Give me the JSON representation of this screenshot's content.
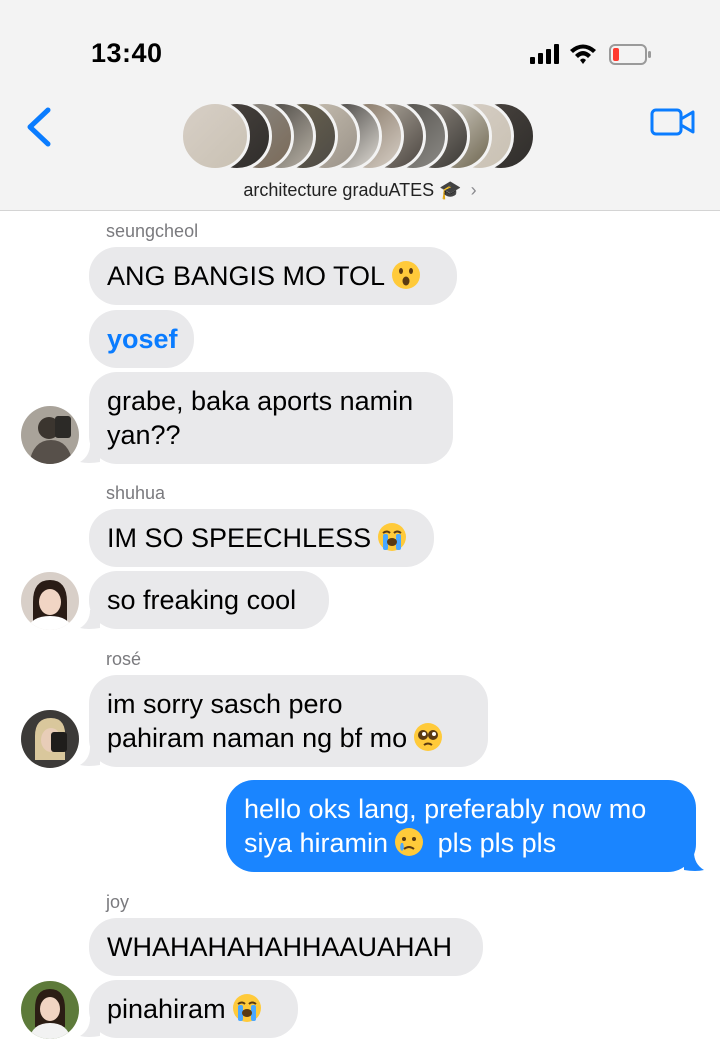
{
  "status_bar": {
    "time": "13:40"
  },
  "header": {
    "group_name": "architecture graduATES",
    "group_emoji": "🎓",
    "chevron": "›"
  },
  "messages": [
    {
      "type": "sender",
      "name": "seungcheol"
    },
    {
      "type": "in",
      "text": "ANG BANGIS MO TOL",
      "emoji": "hushed-face"
    },
    {
      "type": "in",
      "text": "yosef",
      "mention": true
    },
    {
      "type": "in",
      "text": "grabe, baka aports namin\nyan??",
      "avatar": true
    },
    {
      "type": "sender",
      "name": "shuhua"
    },
    {
      "type": "in",
      "text": "IM SO SPEECHLESS",
      "emoji": "loudly-crying-face"
    },
    {
      "type": "in",
      "text": "so freaking cool",
      "avatar": true
    },
    {
      "type": "sender",
      "name": "rosé"
    },
    {
      "type": "in",
      "text": "im sorry sasch pero\npahiram naman ng bf mo",
      "emoji": "pleading-face",
      "avatar": true
    },
    {
      "type": "out",
      "text": "hello oks lang, preferably now mo\nsiya hiramin",
      "emoji": "crying-face",
      "text_after": "pls pls pls"
    },
    {
      "type": "sender",
      "name": "joy"
    },
    {
      "type": "in",
      "text": "WHAHAHAHAHHAAUAHAH"
    },
    {
      "type": "in",
      "text": "pinahiram",
      "emoji": "loudly-crying-face",
      "avatar": true
    }
  ],
  "colors": {
    "incoming_bubble": "#e9e9eb",
    "outgoing_bubble": "#1a85ff",
    "accent_blue": "#0a7cff",
    "header_bg": "#f3f3f3"
  }
}
